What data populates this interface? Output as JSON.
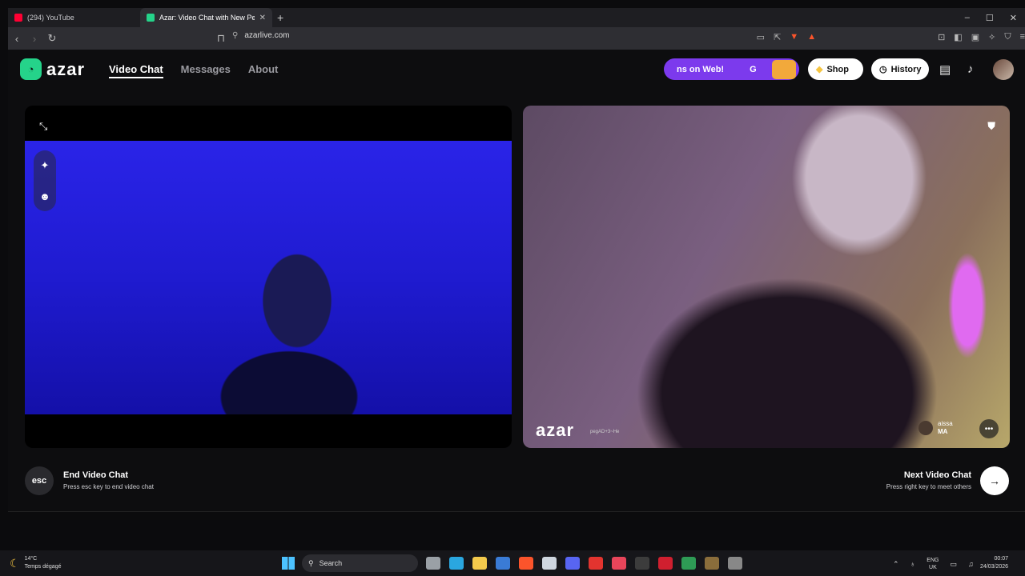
{
  "browser": {
    "tabs": [
      {
        "title": "(294) YouTube",
        "favicon_color": "#ff0033",
        "active": false
      },
      {
        "title": "Azar: Video Chat with New Pe",
        "favicon_color": "#25d38a",
        "active": true
      }
    ],
    "new_tab": "+",
    "url": "azarlive.com",
    "window_controls": [
      "–",
      "☐",
      "✕"
    ]
  },
  "site": {
    "logo_text": "azar",
    "nav": [
      "Video Chat",
      "Messages",
      "About"
    ],
    "promo_text": "ns on Web!",
    "promo_letter": "G",
    "shop_label": "Shop",
    "history_label": "History"
  },
  "remote": {
    "watermark": "azar",
    "stream_id": "pegAD+3~He",
    "user_name": "aissa",
    "user_country": "MA"
  },
  "controls": {
    "esc_label": "esc",
    "end_title": "End Video Chat",
    "end_sub": "Press esc key to end video chat",
    "next_title": "Next Video Chat",
    "next_sub": "Press right key to meet others"
  },
  "taskbar": {
    "temperature": "14°C",
    "weather": "Temps dégagé",
    "search_placeholder": "Search",
    "lang_top": "ENG",
    "lang_bottom": "UK",
    "time": "00:07",
    "date": "24/03/2026",
    "app_colors": [
      "#9aa0a6",
      "#2aa7e0",
      "#f2c94c",
      "#3a7bd5",
      "#fb542b",
      "#cfd6df",
      "#5865f2",
      "#e3342f",
      "#e8455a",
      "#3c3c3c",
      "#d01f2f",
      "#2e9b55",
      "#8a6d3b",
      "#888888"
    ]
  },
  "accent": "#7c3aed"
}
